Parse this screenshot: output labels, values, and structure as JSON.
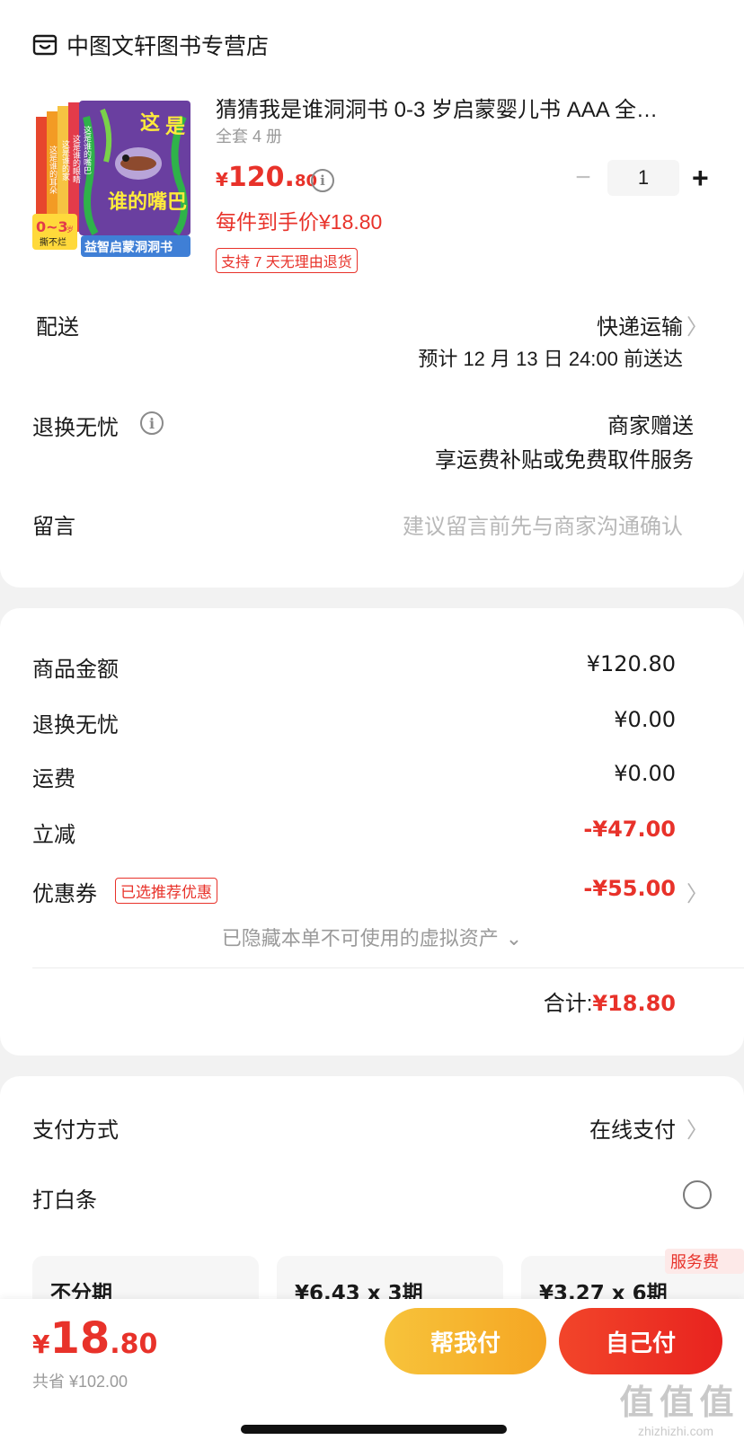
{
  "shop": {
    "name": "中图文轩图书专营店",
    "icon": "shop-icon"
  },
  "product": {
    "title": "猜猜我是谁洞洞书 0-3 岁启蒙婴儿书 AAA 全…",
    "spec": "全套 4 册",
    "price_symbol": "¥",
    "price_int": "120.",
    "price_dec": "80",
    "per_item_price": "每件到手价¥18.80",
    "return_tag": "支持 7 天无理由退货",
    "quantity": "1",
    "image": {
      "top_text_1": "这",
      "top_text_2": "是",
      "bottom_text": "谁的嘴巴",
      "badge_age": "0~3",
      "badge_age_unit": "岁",
      "badge_sub": "撕不烂",
      "banner": "益智启蒙洞洞书",
      "spine_1": "这是谁的嘴巴",
      "spine_2": "这是谁的眼睛",
      "spine_3": "这是谁的家",
      "spine_4": "这是谁的耳朵"
    }
  },
  "delivery": {
    "label": "配送",
    "method": "快递运输",
    "eta": "预计 12 月 13 日 24:00 前送达"
  },
  "return_service": {
    "label": "退换无忧",
    "value": "商家赠送",
    "desc": "享运费补贴或免费取件服务"
  },
  "message": {
    "label": "留言",
    "placeholder": "建议留言前先与商家沟通确认"
  },
  "summary": {
    "rows": [
      {
        "label": "商品金额",
        "value": "¥120.80"
      },
      {
        "label": "退换无忧",
        "value": "¥0.00"
      },
      {
        "label": "运费",
        "value": "¥0.00"
      },
      {
        "label": "立减",
        "value": "-¥47.00"
      },
      {
        "label": "优惠券",
        "value": "-¥55.00"
      }
    ],
    "coupon_tag": "已选推荐优惠",
    "hidden_assets": "已隐藏本单不可使用的虚拟资产",
    "total_label": "合计:",
    "total_value": "¥18.80"
  },
  "payment": {
    "label": "支付方式",
    "value": "在线支付",
    "baitiao_label": "打白条",
    "plans": [
      "不分期",
      "¥6.43 x 3期",
      "¥3.27 x 6期"
    ],
    "service_tag": "服务费"
  },
  "bottom": {
    "currency": "¥",
    "price_int": "18",
    "price_dec": ".80",
    "saved": "共省 ¥102.00",
    "help_pay": "帮我付",
    "self_pay": "自己付"
  },
  "watermark": "值 值 值",
  "watermark_url": "zhizhizhi.com",
  "colors": {
    "accent": "#e8322a",
    "help_btn": "#f7b731",
    "pay_btn": "#ef2f23"
  }
}
